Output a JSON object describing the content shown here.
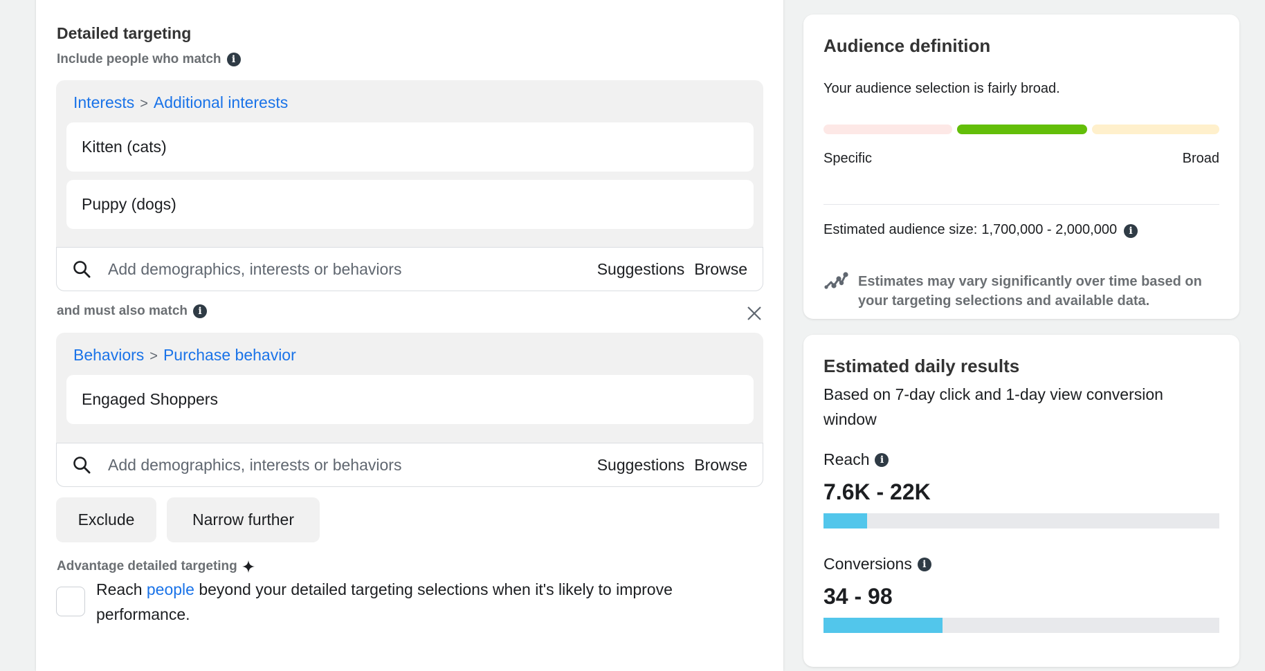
{
  "detailed_targeting": {
    "title": "Detailed targeting",
    "include_label": "Include people who match",
    "groups": [
      {
        "breadcrumb": [
          "Interests",
          "Additional interests"
        ],
        "separator": ">",
        "items": [
          "Kitten (cats)",
          "Puppy (dogs)"
        ],
        "search_placeholder": "Add demographics, interests or behaviors",
        "suggestions_label": "Suggestions",
        "browse_label": "Browse"
      },
      {
        "breadcrumb": [
          "Behaviors",
          "Purchase behavior"
        ],
        "separator": ">",
        "items": [
          "Engaged Shoppers"
        ],
        "search_placeholder": "Add demographics, interests or behaviors",
        "suggestions_label": "Suggestions",
        "browse_label": "Browse"
      }
    ],
    "must_also_match_label": "and must also match",
    "exclude_label": "Exclude",
    "narrow_further_label": "Narrow further",
    "advantage": {
      "title": "Advantage detailed targeting",
      "text_before": "Reach ",
      "link": "people",
      "text_after": " beyond your detailed targeting selections when it's likely to improve performance.",
      "checked": false
    }
  },
  "audience_definition": {
    "title": "Audience definition",
    "summary": "Your audience selection is fairly broad.",
    "meter": {
      "segments": [
        "specific",
        "fairly-broad",
        "broad"
      ],
      "active_segment": 1,
      "colors": {
        "inactive_low": "#fde8e6",
        "active": "#63be09",
        "inactive_high": "#fff0cc"
      }
    },
    "specific_label": "Specific",
    "broad_label": "Broad",
    "size_label": "Estimated audience size:",
    "size_value": "1,700,000 - 2,000,000",
    "note": "Estimates may vary significantly over time based on your targeting selections and available data."
  },
  "daily_results": {
    "title": "Estimated daily results",
    "subtitle": "Based on 7-day click and 1-day view conversion window",
    "reach": {
      "label": "Reach",
      "value": "7.6K - 22K",
      "fill_fraction": 0.11
    },
    "conversions": {
      "label": "Conversions",
      "value": "34 - 98",
      "fill_fraction": 0.3
    },
    "bar_color": "#52c6eb"
  },
  "colors": {
    "link": "#1a73e8",
    "background": "#f0f2f2"
  }
}
